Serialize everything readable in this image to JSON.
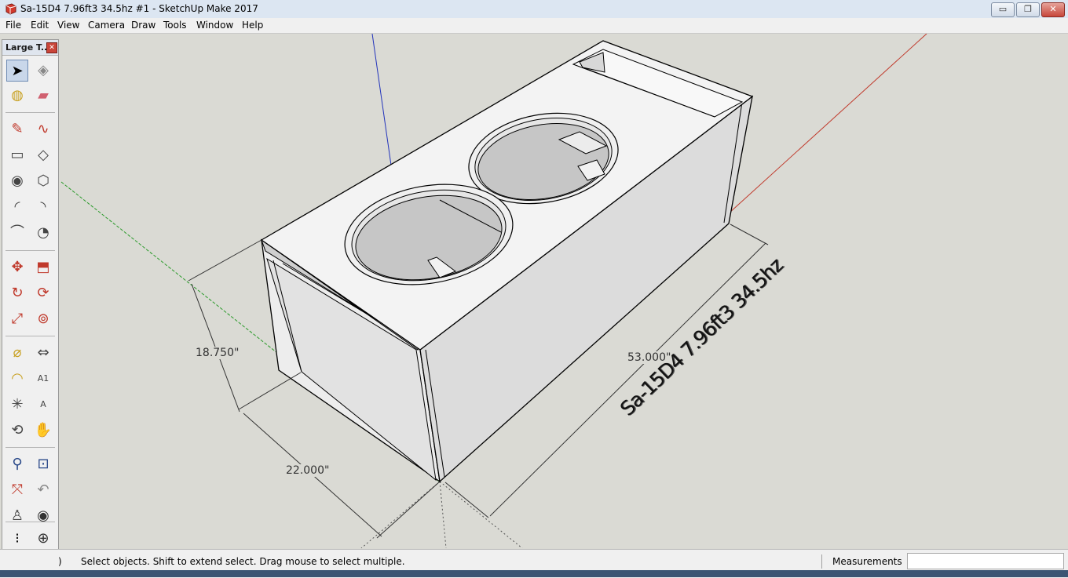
{
  "window": {
    "title": "Sa-15D4 7.96ft3 34.5hz #1 - SketchUp Make 2017"
  },
  "controls": {
    "minimize": "▭",
    "maximize": "❐",
    "close": "✕"
  },
  "menu": [
    "File",
    "Edit",
    "View",
    "Camera",
    "Draw",
    "Tools",
    "Window",
    "Help"
  ],
  "toolbar": {
    "title": "Large T...",
    "close": "✕",
    "tools": [
      {
        "name": "select-tool",
        "icon": "arrow-icon"
      },
      {
        "name": "make-component-tool",
        "icon": "component-icon"
      },
      {
        "name": "paint-bucket-tool",
        "icon": "paint-bucket-icon"
      },
      {
        "name": "eraser-tool",
        "icon": "eraser-icon"
      },
      {
        "name": "line-tool",
        "icon": "pencil-icon"
      },
      {
        "name": "freehand-tool",
        "icon": "freehand-icon"
      },
      {
        "name": "rectangle-tool",
        "icon": "rectangle-icon"
      },
      {
        "name": "rotated-rectangle-tool",
        "icon": "rotated-rectangle-icon"
      },
      {
        "name": "circle-tool",
        "icon": "circle-icon"
      },
      {
        "name": "polygon-tool",
        "icon": "polygon-icon"
      },
      {
        "name": "arc-tool",
        "icon": "arc-icon"
      },
      {
        "name": "two-point-arc-tool",
        "icon": "two-point-arc-icon"
      },
      {
        "name": "three-point-arc-tool",
        "icon": "three-point-arc-icon"
      },
      {
        "name": "pie-tool",
        "icon": "pie-icon"
      },
      {
        "name": "move-tool",
        "icon": "move-icon"
      },
      {
        "name": "push-pull-tool",
        "icon": "push-pull-icon"
      },
      {
        "name": "rotate-tool",
        "icon": "rotate-icon"
      },
      {
        "name": "follow-me-tool",
        "icon": "follow-me-icon"
      },
      {
        "name": "scale-tool",
        "icon": "scale-icon"
      },
      {
        "name": "offset-tool",
        "icon": "offset-icon"
      },
      {
        "name": "tape-measure-tool",
        "icon": "tape-measure-icon"
      },
      {
        "name": "dimension-tool",
        "icon": "dimension-icon"
      },
      {
        "name": "protractor-tool",
        "icon": "protractor-icon"
      },
      {
        "name": "text-tool",
        "icon": "text-icon",
        "glyph": "A1"
      },
      {
        "name": "axes-tool",
        "icon": "axes-icon"
      },
      {
        "name": "3d-text-tool",
        "icon": "3d-text-icon",
        "glyph": "A"
      },
      {
        "name": "orbit-tool",
        "icon": "orbit-icon"
      },
      {
        "name": "pan-tool",
        "icon": "hand-icon"
      },
      {
        "name": "zoom-tool",
        "icon": "magnifier-icon"
      },
      {
        "name": "zoom-window-tool",
        "icon": "zoom-window-icon"
      },
      {
        "name": "zoom-extents-tool",
        "icon": "zoom-extents-icon"
      },
      {
        "name": "previous-view-tool",
        "icon": "previous-view-icon"
      },
      {
        "name": "position-camera-tool",
        "icon": "position-camera-icon"
      },
      {
        "name": "look-around-tool",
        "icon": "eye-icon"
      },
      {
        "name": "walk-tool",
        "icon": "footprints-icon"
      },
      {
        "name": "section-plane-tool",
        "icon": "section-plane-icon"
      }
    ]
  },
  "model": {
    "dimensions": {
      "height": "18.750\"",
      "depth": "22.000\"",
      "length": "53.000\""
    },
    "label_3d": "Sa-15D4 7.96ft3 34.5hz"
  },
  "status": {
    "message": "Select objects. Shift to extend select. Drag mouse to select multiple.",
    "measurements_label": "Measurements",
    "measurements_value": ""
  },
  "colors": {
    "axis_red": "#c0392b",
    "axis_green": "#2a9a2a",
    "axis_blue": "#2233bb",
    "background": "#dadad4"
  }
}
